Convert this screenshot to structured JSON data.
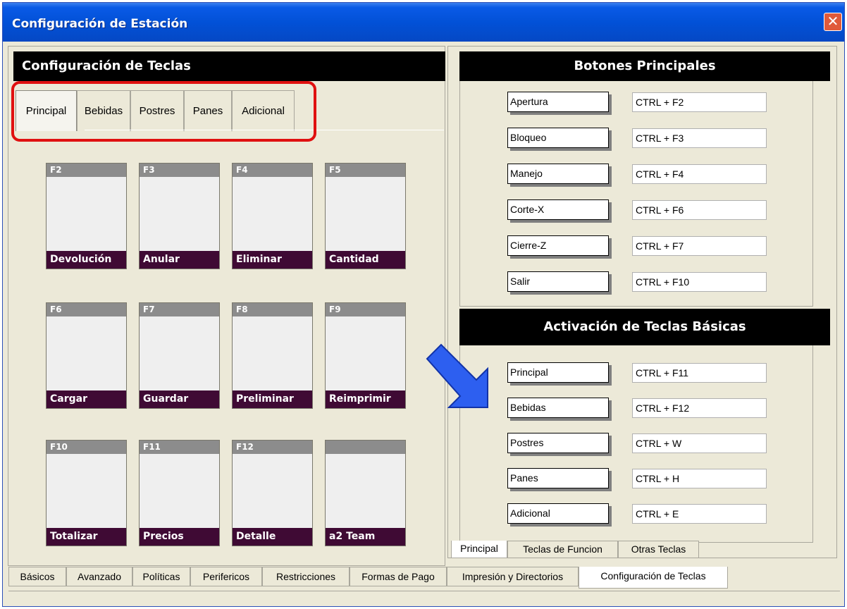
{
  "window": {
    "title": "Configuración de Estación",
    "close_glyph": "✕"
  },
  "left": {
    "header": "Configuración de Teclas",
    "tabs": [
      "Principal",
      "Bebidas",
      "Postres",
      "Panes",
      "Adicional"
    ],
    "keys": [
      {
        "key": "F2",
        "label": "Devolución"
      },
      {
        "key": "F3",
        "label": "Anular"
      },
      {
        "key": "F4",
        "label": "Eliminar"
      },
      {
        "key": "F5",
        "label": "Cantidad"
      },
      {
        "key": "F6",
        "label": "Cargar"
      },
      {
        "key": "F7",
        "label": "Guardar"
      },
      {
        "key": "F8",
        "label": "Preliminar"
      },
      {
        "key": "F9",
        "label": "Reimprimir"
      },
      {
        "key": "F10",
        "label": "Totalizar"
      },
      {
        "key": "F11",
        "label": "Precios"
      },
      {
        "key": "F12",
        "label": "Detalle"
      },
      {
        "key": "",
        "label": "a2 Team"
      }
    ]
  },
  "right": {
    "botones_header": "Botones Principales",
    "botones": [
      {
        "label": "Apertura",
        "value": "CTRL + F2"
      },
      {
        "label": "Bloqueo",
        "value": "CTRL + F3"
      },
      {
        "label": "Manejo",
        "value": "CTRL + F4"
      },
      {
        "label": "Corte-X",
        "value": "CTRL + F6"
      },
      {
        "label": "Cierre-Z",
        "value": "CTRL + F7"
      },
      {
        "label": "Salir",
        "value": "CTRL + F10"
      }
    ],
    "activacion_header": "Activación de Teclas Básicas",
    "activacion": [
      {
        "label": "Principal",
        "value": "CTRL + F11"
      },
      {
        "label": "Bebidas",
        "value": "CTRL + F12"
      },
      {
        "label": "Postres",
        "value": "CTRL + W"
      },
      {
        "label": "Panes",
        "value": "CTRL + H"
      },
      {
        "label": "Adicional",
        "value": "CTRL + E"
      }
    ],
    "tabs": [
      "Principal",
      "Teclas de Funcion",
      "Otras Teclas"
    ]
  },
  "bottom_tabs": [
    "Básicos",
    "Avanzado",
    "Políticas",
    "Perifericos",
    "Restricciones",
    "Formas de Pago",
    "Impresión y Directorios",
    "Configuración de Teclas"
  ],
  "colors": {
    "title_bar": "#0251d7",
    "key_footer": "#3f0a34",
    "highlight_outline": "#e01010",
    "arrow": "#2d5ff0"
  },
  "icons": [
    "close-icon",
    "pointer-arrow-icon"
  ]
}
